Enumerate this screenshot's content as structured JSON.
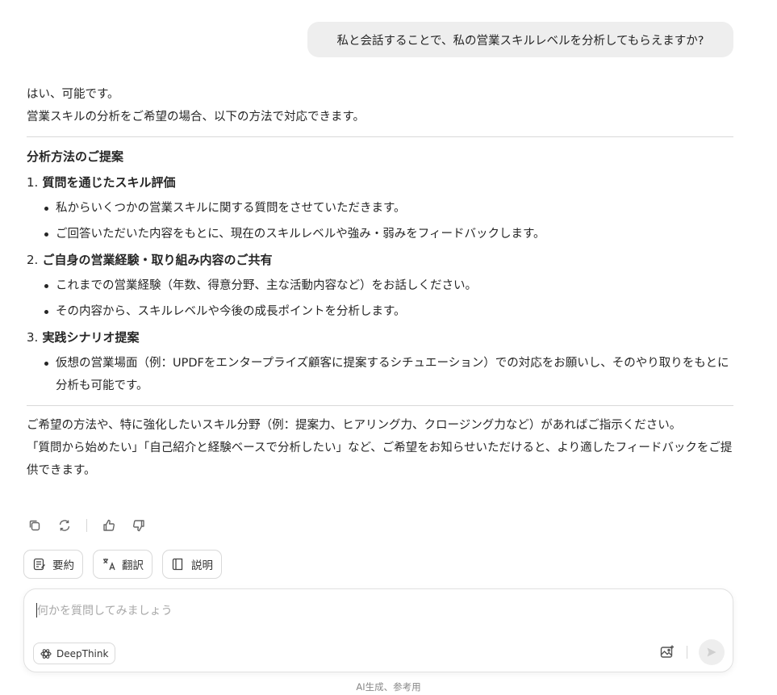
{
  "user_message": "私と会話することで、私の営業スキルレベルを分析してもらえますか?",
  "answer": {
    "intro": [
      "はい、可能です。",
      "営業スキルの分析をご希望の場合、以下の方法で対応できます。"
    ],
    "section_title": "分析方法のご提案",
    "items": [
      {
        "num": "1.",
        "title": "質問を通じたスキル評価",
        "bullets": [
          "私からいくつかの営業スキルに関する質問をさせていただきます。",
          "ご回答いただいた内容をもとに、現在のスキルレベルや強み・弱みをフィードバックします。"
        ]
      },
      {
        "num": "2.",
        "title": "ご自身の営業経験・取り組み内容のご共有",
        "bullets": [
          "これまでの営業経験（年数、得意分野、主な活動内容など）をお話しください。",
          "その内容から、スキルレベルや今後の成長ポイントを分析します。"
        ]
      },
      {
        "num": "3.",
        "title": "実践シナリオ提案",
        "bullets": [
          "仮想の営業場面（例：UPDFをエンタープライズ顧客に提案するシチュエーション）での対応をお願いし、そのやり取りをもとに分析も可能です。"
        ]
      }
    ],
    "closing": [
      "ご希望の方法や、特に強化したいスキル分野（例：提案力、ヒアリング力、クロージング力など）があればご指示ください。",
      "「質問から始めたい」「自己紹介と経験ベースで分析したい」など、ご希望をお知らせいただけると、より適したフィードバックをご提供できます。"
    ]
  },
  "message_actions": [
    "copy-icon",
    "regenerate-icon",
    "thumbs-up-icon",
    "thumbs-down-icon"
  ],
  "quick_actions": {
    "summarize": "要約",
    "translate": "翻訳",
    "explain": "説明"
  },
  "composer": {
    "placeholder": "何かを質問してみましょう",
    "deepthink_label": "DeepThink"
  },
  "footer_note": "AI生成、参考用"
}
